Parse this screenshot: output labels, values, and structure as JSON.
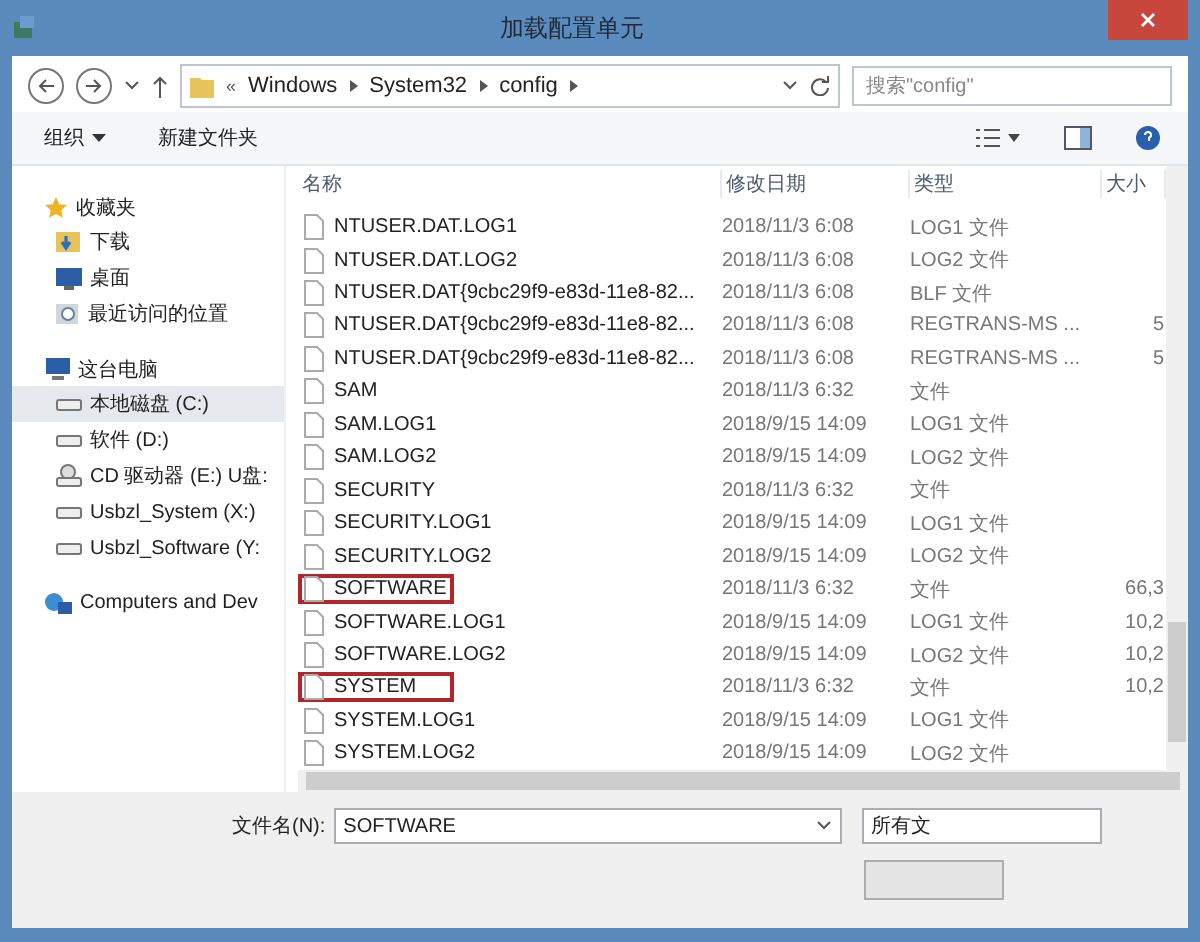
{
  "window": {
    "title": "加载配置单元"
  },
  "address": {
    "overflow": "«",
    "crumbs": [
      "Windows",
      "System32",
      "config"
    ],
    "search_placeholder": "搜索\"config\""
  },
  "toolbar": {
    "organize": "组织",
    "new_folder": "新建文件夹"
  },
  "sidebar": [
    {
      "label": "收藏夹",
      "kind": "star",
      "children": [
        {
          "label": "下载",
          "kind": "download",
          "selected": false
        },
        {
          "label": "桌面",
          "kind": "desktop",
          "selected": false
        },
        {
          "label": "最近访问的位置",
          "kind": "recent",
          "selected": false
        }
      ]
    },
    {
      "label": "这台电脑",
      "kind": "computer",
      "children": [
        {
          "label": "本地磁盘 (C:)",
          "kind": "drive",
          "selected": true
        },
        {
          "label": "软件 (D:)",
          "kind": "drive",
          "selected": false
        },
        {
          "label": "CD 驱动器 (E:) U盘:",
          "kind": "cd",
          "selected": false
        },
        {
          "label": "Usbzl_System (X:)",
          "kind": "drive",
          "selected": false
        },
        {
          "label": "Usbzl_Software (Y:",
          "kind": "drive",
          "selected": false
        }
      ]
    },
    {
      "label": "Computers and Dev",
      "kind": "network"
    }
  ],
  "table": {
    "columns": [
      "名称",
      "修改日期",
      "类型",
      "大小"
    ],
    "rows": [
      {
        "name": "NTUSER.DAT.LOG1",
        "date": "2018/11/3 6:08",
        "type": "LOG1 文件",
        "size": "",
        "highlighted": false
      },
      {
        "name": "NTUSER.DAT.LOG2",
        "date": "2018/11/3 6:08",
        "type": "LOG2 文件",
        "size": "",
        "highlighted": false
      },
      {
        "name": "NTUSER.DAT{9cbc29f9-e83d-11e8-82...",
        "date": "2018/11/3 6:08",
        "type": "BLF 文件",
        "size": "",
        "highlighted": false
      },
      {
        "name": "NTUSER.DAT{9cbc29f9-e83d-11e8-82...",
        "date": "2018/11/3 6:08",
        "type": "REGTRANS-MS ...",
        "size": "5",
        "highlighted": false
      },
      {
        "name": "NTUSER.DAT{9cbc29f9-e83d-11e8-82...",
        "date": "2018/11/3 6:08",
        "type": "REGTRANS-MS ...",
        "size": "5",
        "highlighted": false
      },
      {
        "name": "SAM",
        "date": "2018/11/3 6:32",
        "type": "文件",
        "size": "",
        "highlighted": false
      },
      {
        "name": "SAM.LOG1",
        "date": "2018/9/15 14:09",
        "type": "LOG1 文件",
        "size": "",
        "highlighted": false
      },
      {
        "name": "SAM.LOG2",
        "date": "2018/9/15 14:09",
        "type": "LOG2 文件",
        "size": "",
        "highlighted": false
      },
      {
        "name": "SECURITY",
        "date": "2018/11/3 6:32",
        "type": "文件",
        "size": "",
        "highlighted": false
      },
      {
        "name": "SECURITY.LOG1",
        "date": "2018/9/15 14:09",
        "type": "LOG1 文件",
        "size": "",
        "highlighted": false
      },
      {
        "name": "SECURITY.LOG2",
        "date": "2018/9/15 14:09",
        "type": "LOG2 文件",
        "size": "",
        "highlighted": false
      },
      {
        "name": "SOFTWARE",
        "date": "2018/11/3 6:32",
        "type": "文件",
        "size": "66,3",
        "highlighted": true
      },
      {
        "name": "SOFTWARE.LOG1",
        "date": "2018/9/15 14:09",
        "type": "LOG1 文件",
        "size": "10,2",
        "highlighted": false
      },
      {
        "name": "SOFTWARE.LOG2",
        "date": "2018/9/15 14:09",
        "type": "LOG2 文件",
        "size": "10,2",
        "highlighted": false
      },
      {
        "name": "SYSTEM",
        "date": "2018/11/3 6:32",
        "type": "文件",
        "size": "10,2",
        "highlighted": true
      },
      {
        "name": "SYSTEM.LOG1",
        "date": "2018/9/15 14:09",
        "type": "LOG1 文件",
        "size": "",
        "highlighted": false
      },
      {
        "name": "SYSTEM.LOG2",
        "date": "2018/9/15 14:09",
        "type": "LOG2 文件",
        "size": "",
        "highlighted": false
      }
    ]
  },
  "footer": {
    "filename_label": "文件名(N):",
    "filename": "SOFTWARE",
    "filetype": "所有文"
  }
}
